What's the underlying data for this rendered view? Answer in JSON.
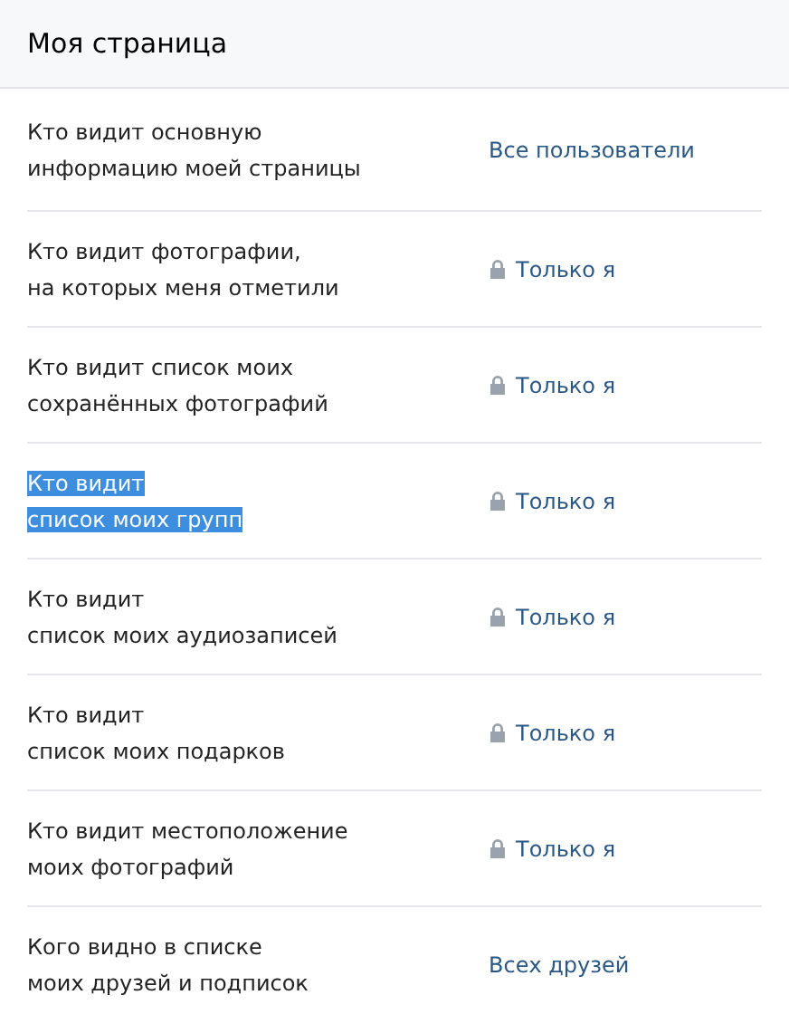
{
  "header": {
    "title": "Моя страница"
  },
  "rows": [
    {
      "label_lines": [
        "Кто видит основную",
        "информацию моей страницы"
      ],
      "highlighted": false,
      "locked": false,
      "value": "Все пользователи"
    },
    {
      "label_lines": [
        "Кто видит фотографии,",
        "на которых меня отметили"
      ],
      "highlighted": false,
      "locked": true,
      "value": "Только я"
    },
    {
      "label_lines": [
        "Кто видит список моих",
        "сохранённых фотографий"
      ],
      "highlighted": false,
      "locked": true,
      "value": "Только я"
    },
    {
      "label_lines": [
        "Кто видит",
        "список моих групп"
      ],
      "highlighted": true,
      "locked": true,
      "value": "Только я"
    },
    {
      "label_lines": [
        "Кто видит",
        "список моих аудиозаписей"
      ],
      "highlighted": false,
      "locked": true,
      "value": "Только я"
    },
    {
      "label_lines": [
        "Кто видит",
        "список моих подарков"
      ],
      "highlighted": false,
      "locked": true,
      "value": "Только я"
    },
    {
      "label_lines": [
        "Кто видит местоположение",
        "моих фотографий"
      ],
      "highlighted": false,
      "locked": true,
      "value": "Только я"
    },
    {
      "label_lines": [
        "Кого видно в списке",
        "моих друзей и подписок"
      ],
      "highlighted": false,
      "locked": false,
      "value": "Всех друзей"
    }
  ]
}
